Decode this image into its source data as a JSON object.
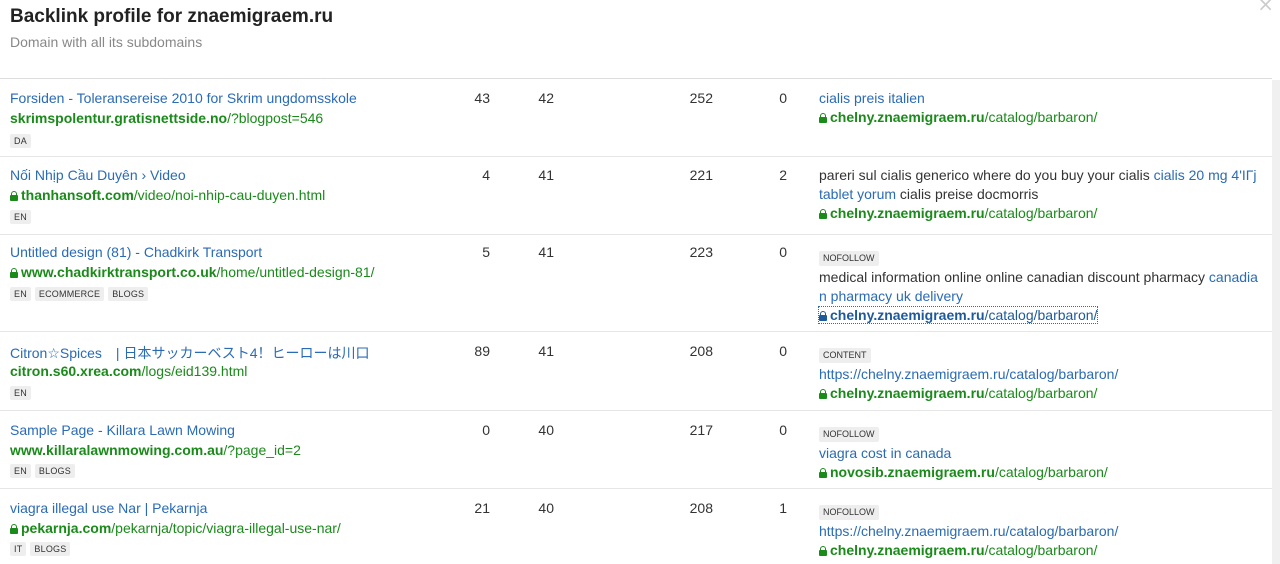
{
  "header": {
    "title": "Backlink profile for znaemigraem.ru",
    "subtitle": "Domain with all its subdomains",
    "close_label": "×"
  },
  "rows": [
    {
      "title": "Forsiden - Toleransereise 2010 for Skrim ungdomsskole",
      "domain": "skrimspolentur.gratisnettside.no",
      "path": "/?blogpost=546",
      "secure": false,
      "tags": [
        "DA"
      ],
      "v1": "43",
      "v2": "42",
      "v3": "252",
      "v4": "0",
      "badge": "",
      "anchor_plain": "",
      "anchor_link": "cialis preis italien",
      "target_domain": "chelny.znaemigraem.ru",
      "target_path": "/catalog/barbaron/"
    },
    {
      "title": "Nối Nhịp Cầu Duyên › Video",
      "domain": "thanhansoft.com",
      "path": "/video/noi-nhip-cau-duyen.html",
      "secure": true,
      "tags": [
        "EN"
      ],
      "v1": "4",
      "v2": "41",
      "v3": "221",
      "v4": "2",
      "badge": "",
      "anchor_plain_1": "pareri sul cialis generico where do you buy your cialis ",
      "anchor_link": "cialis 20 mg 4'IГј tablet yorum",
      "anchor_plain_2": " cialis preise docmorris",
      "target_domain": "chelny.znaemigraem.ru",
      "target_path": "/catalog/barbaron/"
    },
    {
      "title": "Untitled design (81) - Chadkirk Transport",
      "domain": "www.chadkirktransport.co.uk",
      "path": "/home/untitled-design-81/",
      "secure": true,
      "tags": [
        "EN",
        "ECOMMERCE",
        "BLOGS"
      ],
      "v1": "5",
      "v2": "41",
      "v3": "223",
      "v4": "0",
      "badge": "NOFOLLOW",
      "anchor_plain": "medical information online online canadian discount pharmacy ",
      "anchor_link": "canadian pharmacy uk delivery",
      "target_domain": "chelny.znaemigraem.ru",
      "target_path": "/catalog/barbaron/"
    },
    {
      "title": "Citron☆Spices　| 日本サッカーベスト4！ヒーローは川口",
      "domain": "citron.s60.xrea.com",
      "path": "/logs/eid139.html",
      "secure": false,
      "tags": [
        "EN"
      ],
      "v1": "89",
      "v2": "41",
      "v3": "208",
      "v4": "0",
      "badge": "CONTENT",
      "anchor_link": "https://chelny.znaemigraem.ru/catalog/barbaron/",
      "target_domain": "chelny.znaemigraem.ru",
      "target_path": "/catalog/barbaron/"
    },
    {
      "title": "Sample Page - Killara Lawn Mowing",
      "domain": "www.killaralawnmowing.com.au",
      "path": "/?page_id=2",
      "secure": false,
      "tags": [
        "EN",
        "BLOGS"
      ],
      "v1": "0",
      "v2": "40",
      "v3": "217",
      "v4": "0",
      "badge": "NOFOLLOW",
      "anchor_link": "viagra cost in canada",
      "target_domain": "novosib.znaemigraem.ru",
      "target_path": "/catalog/barbaron/"
    },
    {
      "title": "viagra illegal use Nar | Pekarnja",
      "domain": "pekarnja.com",
      "path": "/pekarnja/topic/viagra-illegal-use-nar/",
      "secure": true,
      "tags": [
        "IT",
        "BLOGS"
      ],
      "v1": "21",
      "v2": "40",
      "v3": "208",
      "v4": "1",
      "badge": "NOFOLLOW",
      "anchor_link": "https://chelny.znaemigraem.ru/catalog/barbaron/",
      "target_domain": "chelny.znaemigraem.ru",
      "target_path": "/catalog/barbaron/"
    }
  ]
}
